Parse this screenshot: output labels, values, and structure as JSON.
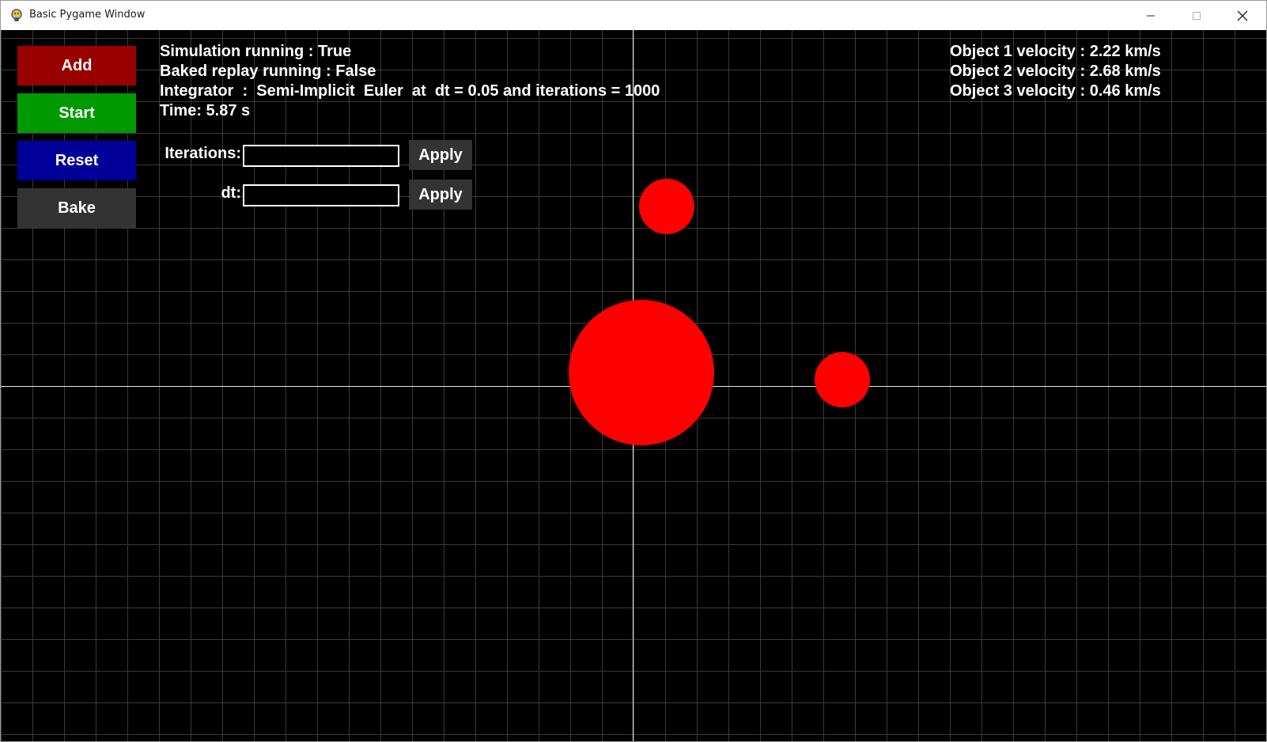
{
  "window": {
    "title": "Basic Pygame Window"
  },
  "sidebar": {
    "buttons": [
      {
        "label": "Add",
        "color": "#990000"
      },
      {
        "label": "Start",
        "color": "#009900"
      },
      {
        "label": "Reset",
        "color": "#000099"
      },
      {
        "label": "Bake",
        "color": "#333333"
      }
    ]
  },
  "status": {
    "simulation_running": "Simulation running : True",
    "baked_replay": "Baked replay running : False",
    "integrator": "Integrator  :  Semi-Implicit  Euler  at  dt = 0.05 and iterations = 1000",
    "time": "Time: 5.87 s"
  },
  "controls": {
    "iterations_label": "Iterations:",
    "iterations_value": "",
    "dt_label": "dt:",
    "dt_value": "",
    "apply_label": "Apply"
  },
  "velocities": [
    "Object 1 velocity : 2.22 km/s",
    "Object 2 velocity : 2.68 km/s",
    "Object 3 velocity : 0.46 km/s"
  ],
  "colors": {
    "body": "#ff0000",
    "grid": "#3a3a3a",
    "axis": "#e8e8e8",
    "background": "#000000"
  },
  "icons": {
    "app": "pygame-snake-icon",
    "minimize": "minimize-icon",
    "maximize": "maximize-icon",
    "close": "close-icon"
  }
}
